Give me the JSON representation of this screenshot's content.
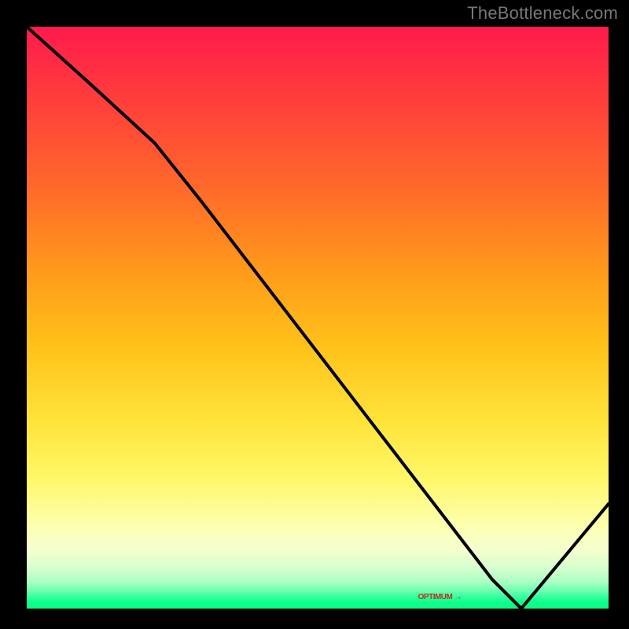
{
  "attribution": "TheBottleneck.com",
  "optimum_marker_label": "OPTIMUM →",
  "colors": {
    "curve": "#000000",
    "marker_text": "#c02f1f"
  },
  "chart_data": {
    "type": "line",
    "title": "",
    "xlabel": "",
    "ylabel": "",
    "xlim": [
      0,
      100
    ],
    "ylim": [
      0,
      100
    ],
    "series": [
      {
        "name": "bottleneck-curve",
        "x": [
          0,
          10,
          22,
          30,
          40,
          50,
          60,
          70,
          80,
          85,
          100
        ],
        "y": [
          100,
          91,
          80,
          70,
          57,
          44,
          31,
          18,
          5,
          0,
          18
        ]
      }
    ],
    "optimum_x": 85,
    "optimum_label": "OPTIMUM →",
    "background_gradient_meaning": "red=high bottleneck, green=no bottleneck"
  }
}
